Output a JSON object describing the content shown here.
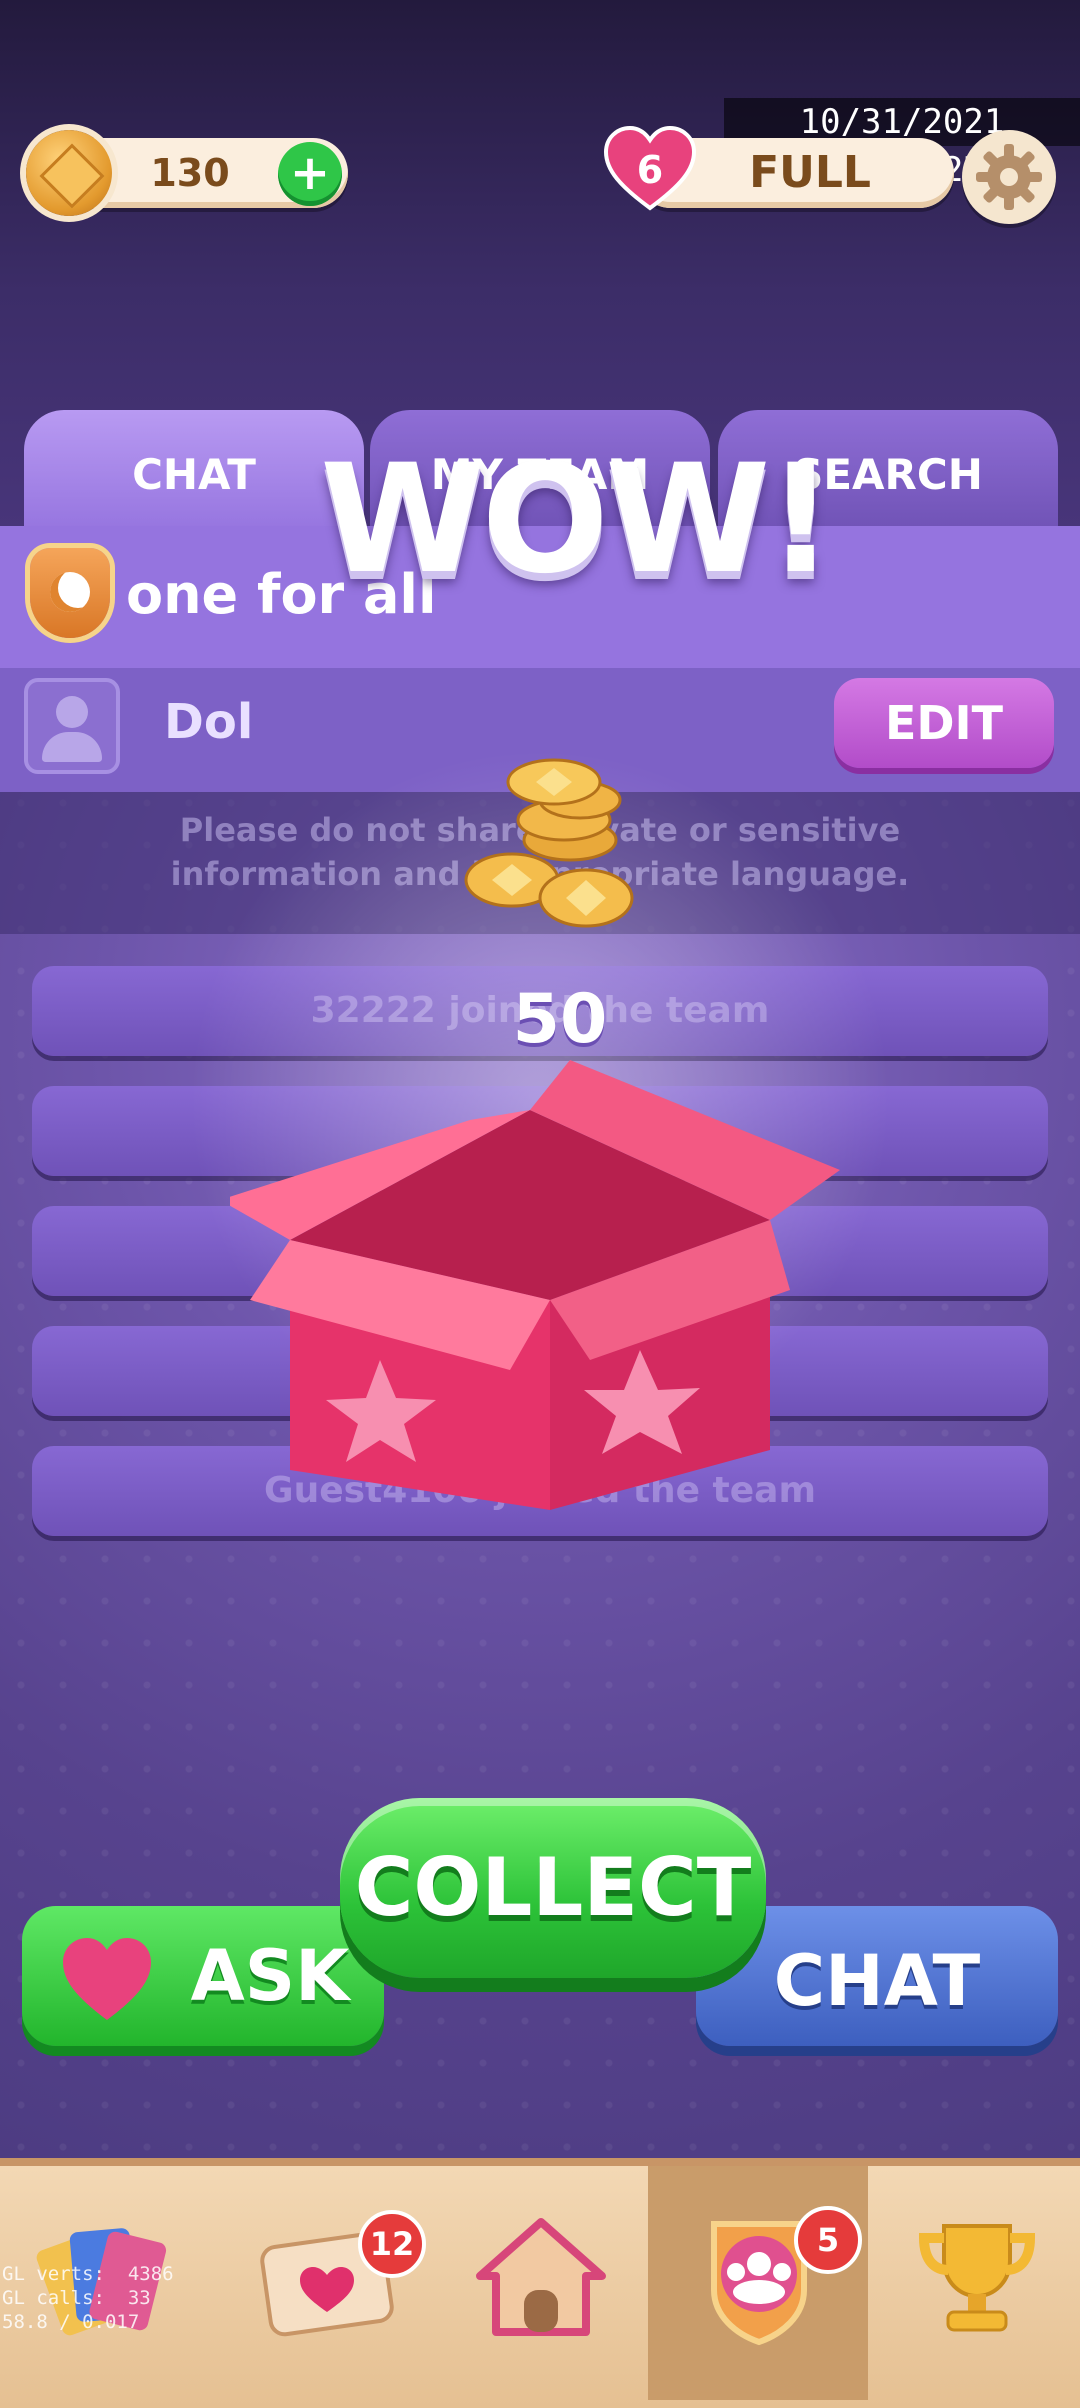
{
  "status": {
    "timestamp": "10/31/2021 15:39:27"
  },
  "header": {
    "coins": "130",
    "lives_count": "6",
    "lives_status": "FULL"
  },
  "tabs": [
    {
      "label": "CHAT"
    },
    {
      "label": "MY TEAM"
    },
    {
      "label": "SEARCH"
    }
  ],
  "team": {
    "name": "one for all"
  },
  "member": {
    "name": "Dol",
    "edit_label": "EDIT"
  },
  "notice": {
    "text": "Please do not share private or sensitive information and inappropriate language."
  },
  "chat_rows": [
    {
      "text": "32222 joined the team"
    },
    {
      "text": ""
    },
    {
      "text": ""
    },
    {
      "text": ""
    },
    {
      "text": "Guest4100 joined the team"
    }
  ],
  "popup": {
    "headline": "WOW!",
    "reward_amount": "50",
    "collect_label": "COLLECT"
  },
  "actions": {
    "ask_label": "ASK",
    "chat_label": "CHAT"
  },
  "bottom_nav": {
    "items": [
      {
        "icon": "cards-icon"
      },
      {
        "icon": "heart-mail-icon",
        "badge": "12"
      },
      {
        "icon": "home-icon"
      },
      {
        "icon": "team-icon",
        "badge": "5",
        "active": true
      },
      {
        "icon": "trophy-icon"
      }
    ]
  },
  "debug_overlay": {
    "text": "GL verts:  4386\nGL calls:  33\n58.8 / 0.017"
  },
  "colors": {
    "accent_green": "#2cc238",
    "accent_purple": "#9574df",
    "badge_red": "#e53b3b"
  }
}
